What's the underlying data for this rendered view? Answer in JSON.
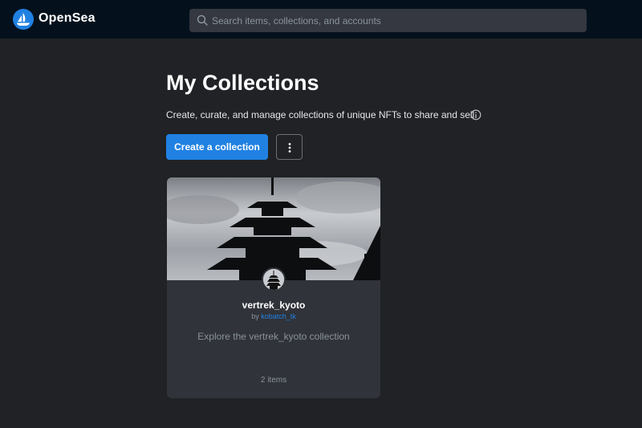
{
  "header": {
    "brand": "OpenSea",
    "logo_icon": "opensea-logo-icon",
    "search_placeholder": "Search items, collections, and accounts"
  },
  "page": {
    "title": "My Collections",
    "subtitle": "Create, curate, and manage collections of unique NFTs to share and sell.",
    "create_button": "Create a collection",
    "more_icon": "more-vertical-icon",
    "info_icon": "info-icon"
  },
  "collections": [
    {
      "name": "vertrek_kyoto",
      "by_prefix": "by ",
      "owner": "kobatch_tk",
      "description": "Explore the vertrek_kyoto collection",
      "items": "2 items",
      "banner": "pagoda-silhouette-image"
    }
  ],
  "colors": {
    "accent": "#2081e2",
    "background": "#202225",
    "header": "#04111d",
    "card": "#303339"
  }
}
